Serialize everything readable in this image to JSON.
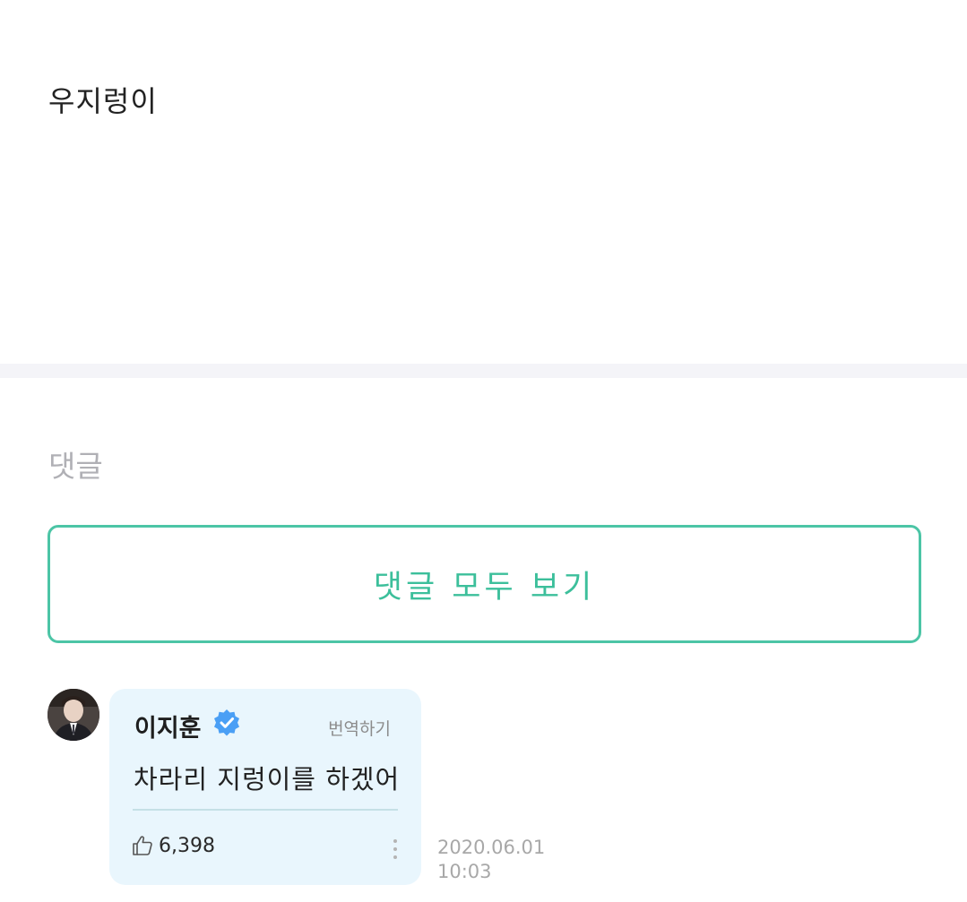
{
  "post": {
    "body_text": "우지렁이"
  },
  "comments": {
    "heading": "댓글",
    "view_all_label": "댓글 모두 보기",
    "items": [
      {
        "author": "이지훈",
        "verified": true,
        "translate_label": "번역하기",
        "text": "차라리 지렁이를 하겠어",
        "likes": "6,398",
        "date": "2020.06.01",
        "time": "10:03"
      }
    ]
  },
  "colors": {
    "accent": "#3cbf9b",
    "bubble_background": "#e9f6fd",
    "verified_badge": "#4a9ff5",
    "divider": "#f4f4f8"
  },
  "icons": [
    "verified-badge-icon",
    "thumbs-up-icon",
    "more-vertical-icon"
  ]
}
